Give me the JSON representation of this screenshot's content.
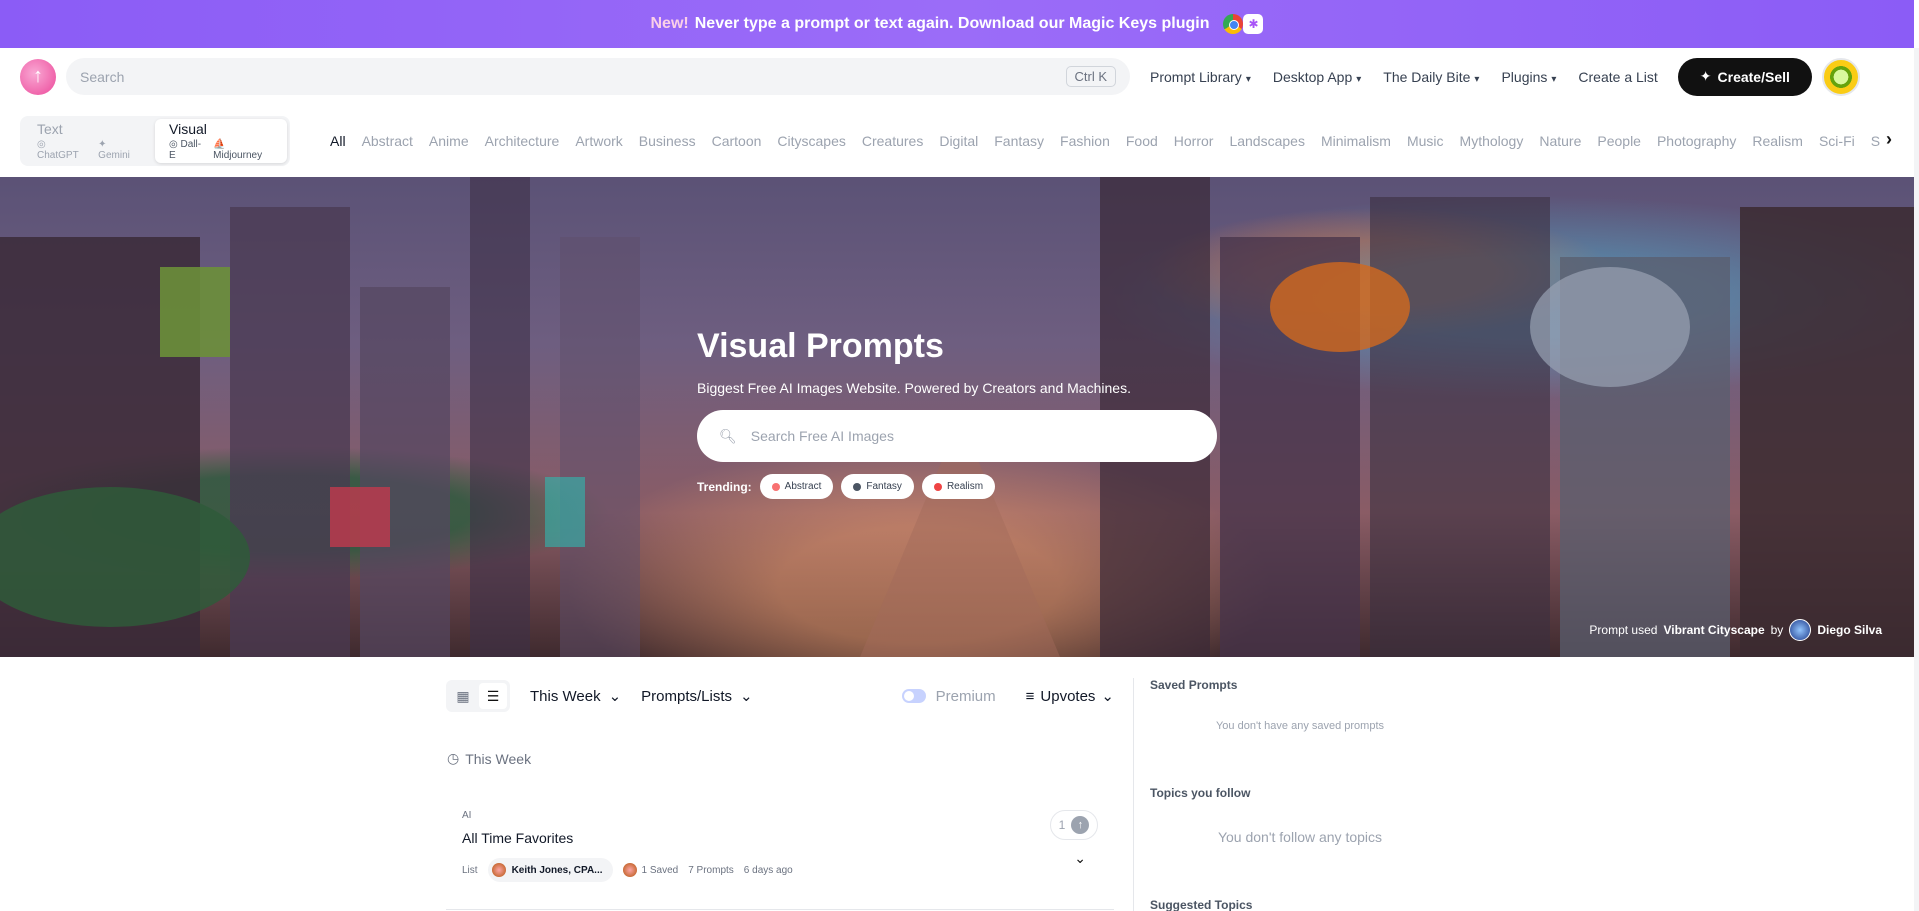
{
  "promo": {
    "new": "New!",
    "text": "Never type a prompt or text again. Download our Magic Keys plugin"
  },
  "nav": {
    "search_placeholder": "Search",
    "shortcut": "Ctrl K",
    "links": [
      "Prompt Library",
      "Desktop App",
      "The Daily Bite",
      "Plugins"
    ],
    "create_list": "Create a List",
    "create_sell": "Create/Sell"
  },
  "modes": {
    "text": {
      "title": "Text",
      "sub1": "ChatGPT",
      "sub2": "Gemini"
    },
    "visual": {
      "title": "Visual",
      "sub1": "Dall-E",
      "sub2": "Midjourney"
    }
  },
  "categories": [
    "All",
    "Abstract",
    "Anime",
    "Architecture",
    "Artwork",
    "Business",
    "Cartoon",
    "Cityscapes",
    "Creatures",
    "Digital",
    "Fantasy",
    "Fashion",
    "Food",
    "Horror",
    "Landscapes",
    "Minimalism",
    "Music",
    "Mythology",
    "Nature",
    "People",
    "Photography",
    "Realism",
    "Sci-Fi",
    "S"
  ],
  "hero": {
    "title": "Visual Prompts",
    "subtitle": "Biggest Free AI Images Website. Powered by Creators and Machines.",
    "search_placeholder": "Search Free AI Images",
    "trending_label": "Trending:",
    "trending": [
      {
        "label": "Abstract",
        "color": "#f87171"
      },
      {
        "label": "Fantasy",
        "color": "#4b5563"
      },
      {
        "label": "Realism",
        "color": "#ef4444"
      }
    ],
    "credit_prefix": "Prompt used",
    "credit_prompt": "Vibrant Cityscape",
    "credit_by": "by",
    "credit_author": "Diego Silva"
  },
  "toolbar": {
    "period": "This Week",
    "type": "Prompts/Lists",
    "premium": "Premium",
    "sort": "Upvotes"
  },
  "section": {
    "label": "This Week"
  },
  "card": {
    "tag": "AI",
    "title": "All Time Favorites",
    "kind": "List",
    "author": "Keith Jones, CPA...",
    "saved": "1 Saved",
    "prompts": "7 Prompts",
    "age": "6 days ago",
    "votes": "1"
  },
  "sidebar": {
    "saved_title": "Saved Prompts",
    "saved_empty": "You don't have any saved prompts",
    "topics_title": "Topics you follow",
    "topics_empty": "You don't follow any topics",
    "suggested_title": "Suggested Topics"
  },
  "colors": {
    "accent": "#8b5cf6",
    "brand_pink": "#ec4899",
    "primary_button": "#111111"
  }
}
